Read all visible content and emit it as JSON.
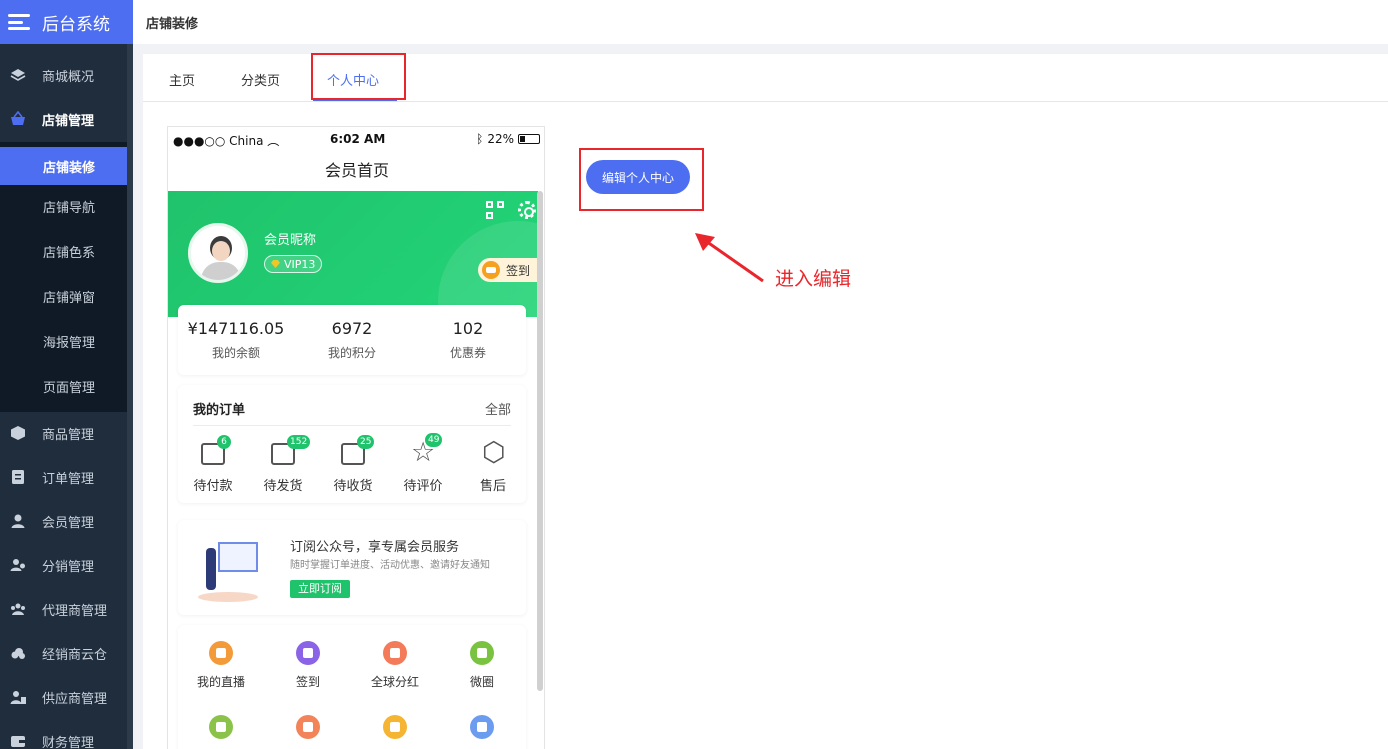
{
  "app": {
    "title": "后台系统"
  },
  "topbar": {
    "breadcrumb": "店铺装修"
  },
  "sidebar": {
    "items": [
      {
        "label": "商城概况",
        "icon": "layers-icon"
      },
      {
        "label": "店铺管理",
        "icon": "basket-icon"
      },
      {
        "label": "商品管理",
        "icon": "box-icon"
      },
      {
        "label": "订单管理",
        "icon": "document-icon"
      },
      {
        "label": "会员管理",
        "icon": "user-icon"
      },
      {
        "label": "分销管理",
        "icon": "users-share-icon"
      },
      {
        "label": "代理商管理",
        "icon": "group-icon"
      },
      {
        "label": "经销商云仓",
        "icon": "cloud-icon"
      },
      {
        "label": "供应商管理",
        "icon": "supplier-icon"
      },
      {
        "label": "财务管理",
        "icon": "wallet-icon"
      }
    ],
    "submenu": [
      "店铺装修",
      "店铺导航",
      "店铺色系",
      "店铺弹窗",
      "海报管理",
      "页面管理"
    ]
  },
  "tabs": [
    "主页",
    "分类页",
    "个人中心"
  ],
  "phone": {
    "status": {
      "carrier": "●●●○○ China",
      "time": "6:02 AM",
      "battery": "22%"
    },
    "page_title": "会员首页",
    "nickname": "会员昵称",
    "vip": "VIP13",
    "signin": "签到",
    "assets": [
      {
        "value": "¥147116.05",
        "label": "我的余额"
      },
      {
        "value": "6972",
        "label": "我的积分"
      },
      {
        "value": "102",
        "label": "优惠券"
      }
    ],
    "orders": {
      "title": "我的订单",
      "all": "全部",
      "items": [
        {
          "label": "待付款",
          "badge": "6"
        },
        {
          "label": "待发货",
          "badge": "152"
        },
        {
          "label": "待收货",
          "badge": "25"
        },
        {
          "label": "待评价",
          "badge": "49"
        },
        {
          "label": "售后",
          "badge": ""
        }
      ]
    },
    "subscribe": {
      "title": "订阅公众号，享专属会员服务",
      "desc": "随时掌握订单进度、活动优惠、邀请好友通知",
      "button": "立即订阅"
    },
    "tools": [
      {
        "label": "我的直播",
        "color": "#f39a3a"
      },
      {
        "label": "签到",
        "color": "#8a63e6"
      },
      {
        "label": "全球分红",
        "color": "#f37b5a"
      },
      {
        "label": "微圈",
        "color": "#79c341"
      },
      {
        "label": "",
        "color": "#8bc34a"
      },
      {
        "label": "",
        "color": "#f3845a"
      },
      {
        "label": "",
        "color": "#f5b431"
      },
      {
        "label": "",
        "color": "#6c9cf0"
      }
    ]
  },
  "edit_button": "编辑个人中心",
  "annotation": "进入编辑",
  "colors": {
    "primary": "#4e6ef2",
    "sidebar": "#1f2d3d",
    "green": "#1fc36b",
    "highlight": "#e8262b"
  }
}
